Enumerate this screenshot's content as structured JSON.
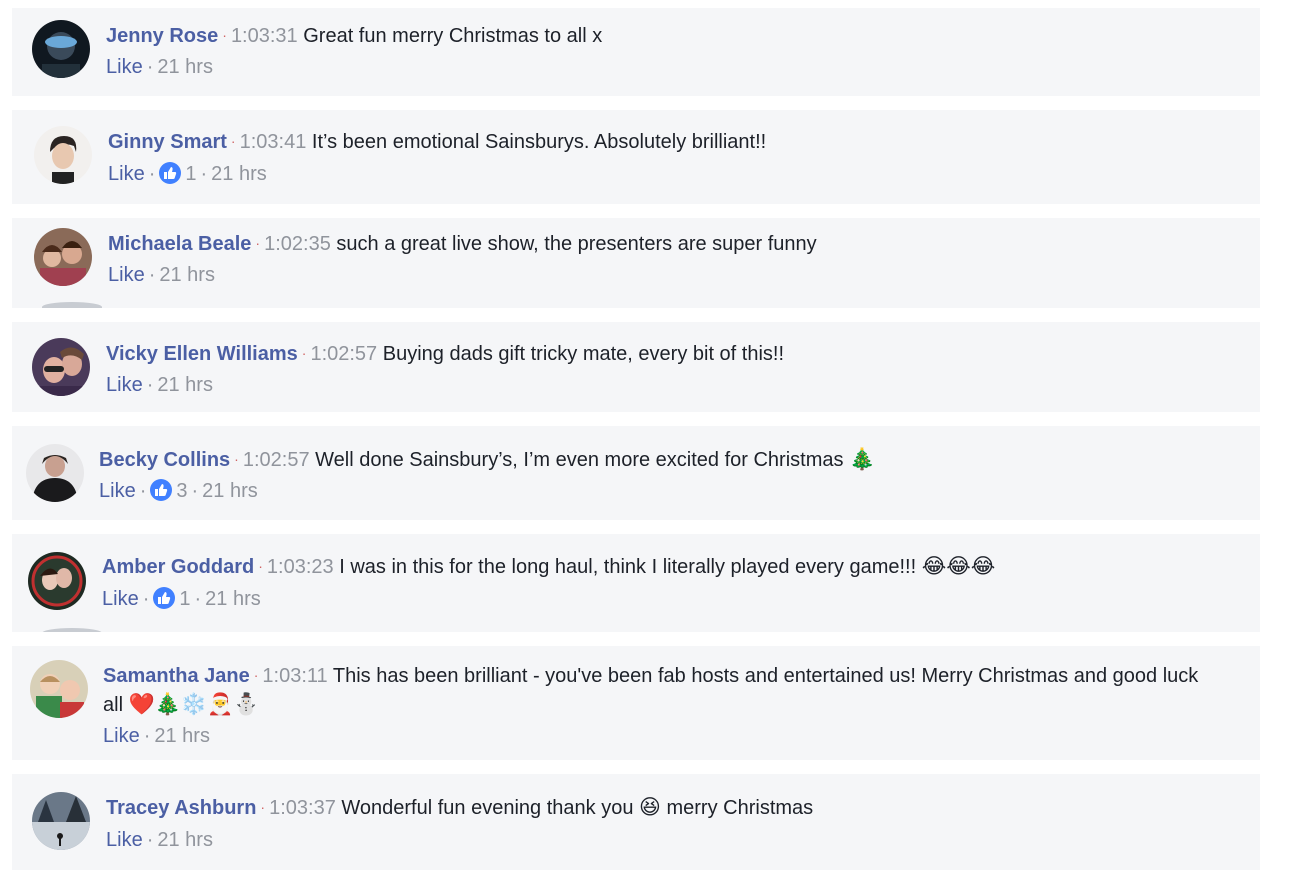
{
  "comments": [
    {
      "author": "Jenny Rose",
      "timestamp": "1:03:31",
      "text": "Great fun merry Christmas to all x",
      "like_label": "Like",
      "reaction_count": "",
      "age": "21 hrs",
      "avatar_color": "#1a2430"
    },
    {
      "author": "Ginny Smart",
      "timestamp": "1:03:41",
      "text": "It’s been emotional Sainsburys. Absolutely brilliant!!",
      "like_label": "Like",
      "reaction_count": "1",
      "age": "21 hrs",
      "avatar_color": "#e8e4e0"
    },
    {
      "author": "Michaela Beale",
      "timestamp": "1:02:35",
      "text": "such a great live show, the presenters are super funny",
      "like_label": "Like",
      "reaction_count": "",
      "age": "21 hrs",
      "avatar_color": "#7a5a48"
    },
    {
      "author": "Vicky Ellen Williams",
      "timestamp": "1:02:57",
      "text": "Buying dads gift tricky mate, every bit of this!!",
      "like_label": "Like",
      "reaction_count": "",
      "age": "21 hrs",
      "avatar_color": "#5a4a6a"
    },
    {
      "author": "Becky Collins",
      "timestamp": "1:02:57",
      "text": "Well done Sainsbury’s, I’m even more excited for Christmas",
      "emoji": "🎄",
      "like_label": "Like",
      "reaction_count": "3",
      "age": "21 hrs",
      "avatar_color": "#2a2a2e"
    },
    {
      "author": "Amber Goddard",
      "timestamp": "1:03:23",
      "text": "I was in this for the long haul, think I literally played every game!!!",
      "emoji": "😂😂😂",
      "like_label": "Like",
      "reaction_count": "1",
      "age": "21 hrs",
      "avatar_color": "#3a4a3a"
    },
    {
      "author": "Samantha Jane",
      "timestamp": "1:03:11",
      "text": "This has been brilliant - you've been fab hosts and entertained us! Merry Christmas and good luck all",
      "emoji": "❤️🎄❄️🎅⛄",
      "like_label": "Like",
      "reaction_count": "",
      "age": "21 hrs",
      "avatar_color": "#c8a888"
    },
    {
      "author": "Tracey Ashburn",
      "timestamp": "1:03:37",
      "text": "Wonderful fun evening thank you",
      "emoji": "😆",
      "text_after": "merry Christmas",
      "like_label": "Like",
      "reaction_count": "",
      "age": "21 hrs",
      "avatar_color": "#4a5868"
    }
  ],
  "colors": {
    "name": "#4b5fa4",
    "meta": "#90949c",
    "card_bg": "#f5f6f8",
    "reaction_blue": "#4080ff"
  }
}
